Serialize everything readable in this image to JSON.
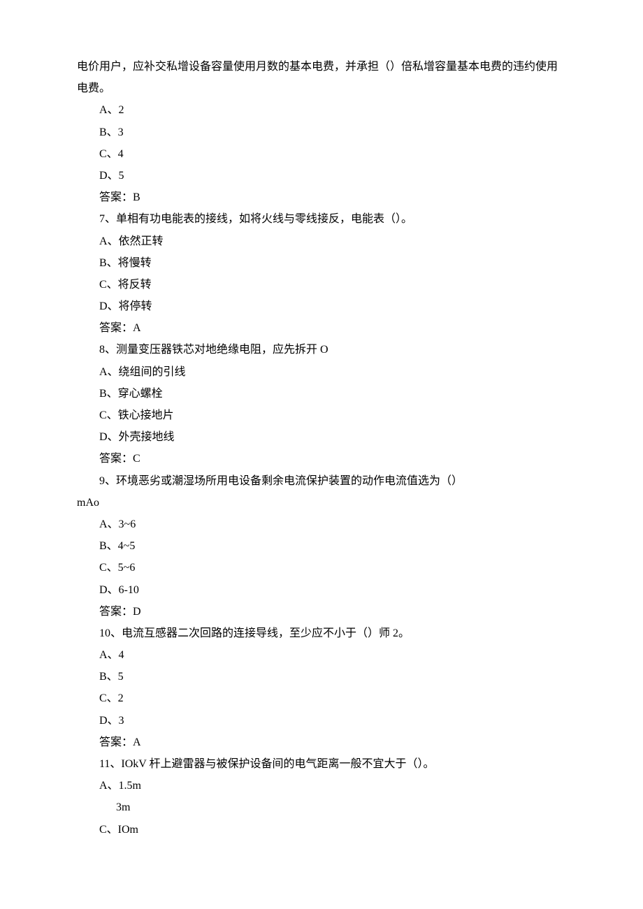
{
  "lines": [
    {
      "cls": "",
      "text": "电价用户，应补交私增设备容量使用月数的基本电费，并承担（）倍私增容量基本电费的违约使用电费。"
    },
    {
      "cls": "indent1",
      "text": "A、2"
    },
    {
      "cls": "indent1",
      "text": "B、3"
    },
    {
      "cls": "indent1",
      "text": "C、4"
    },
    {
      "cls": "indent1",
      "text": "D、5"
    },
    {
      "cls": "indent1",
      "text": "答案：B"
    },
    {
      "cls": "indent1",
      "text": "7、单相有功电能表的接线，如将火线与零线接反，电能表（）。"
    },
    {
      "cls": "indent1",
      "text": "A、依然正转"
    },
    {
      "cls": "indent1",
      "text": "B、将慢转"
    },
    {
      "cls": "indent1",
      "text": "C、将反转"
    },
    {
      "cls": "indent1",
      "text": "D、将停转"
    },
    {
      "cls": "indent1",
      "text": "答案：A"
    },
    {
      "cls": "indent1",
      "text": "8、测量变压器铁芯对地绝缘电阻，应先拆开 O"
    },
    {
      "cls": "indent1",
      "text": "A、绕组间的引线"
    },
    {
      "cls": "indent1",
      "text": "B、穿心螺栓"
    },
    {
      "cls": "indent1",
      "text": "C、铁心接地片"
    },
    {
      "cls": "indent1",
      "text": "D、外壳接地线"
    },
    {
      "cls": "indent1",
      "text": "答案：C"
    },
    {
      "cls": "indent1",
      "text": "9、环境恶劣或潮湿场所用电设备剩余电流保护装置的动作电流值选为（）"
    },
    {
      "cls": "",
      "text": "mAo"
    },
    {
      "cls": "indent1",
      "text": "A、3~6"
    },
    {
      "cls": "indent1",
      "text": "B、4~5"
    },
    {
      "cls": "indent1",
      "text": "C、5~6"
    },
    {
      "cls": "indent1",
      "text": "D、6-10"
    },
    {
      "cls": "indent1",
      "text": "答案：D"
    },
    {
      "cls": "indent1",
      "text": "10、电流互感器二次回路的连接导线，至少应不小于（）师 2。"
    },
    {
      "cls": "indent1",
      "text": "A、4"
    },
    {
      "cls": "indent1",
      "text": "B、5"
    },
    {
      "cls": "indent1",
      "text": "C、2"
    },
    {
      "cls": "indent1",
      "text": "D、3"
    },
    {
      "cls": "indent1",
      "text": "答案：A"
    },
    {
      "cls": "indent1",
      "text": "11、IOkV 杆上避雷器与被保护设备间的电气距离一般不宜大于（）。"
    },
    {
      "cls": "indent1",
      "text": "A、1.5m"
    },
    {
      "cls": "indent2",
      "text": "3m"
    },
    {
      "cls": "indent1",
      "text": "C、IOm"
    }
  ]
}
